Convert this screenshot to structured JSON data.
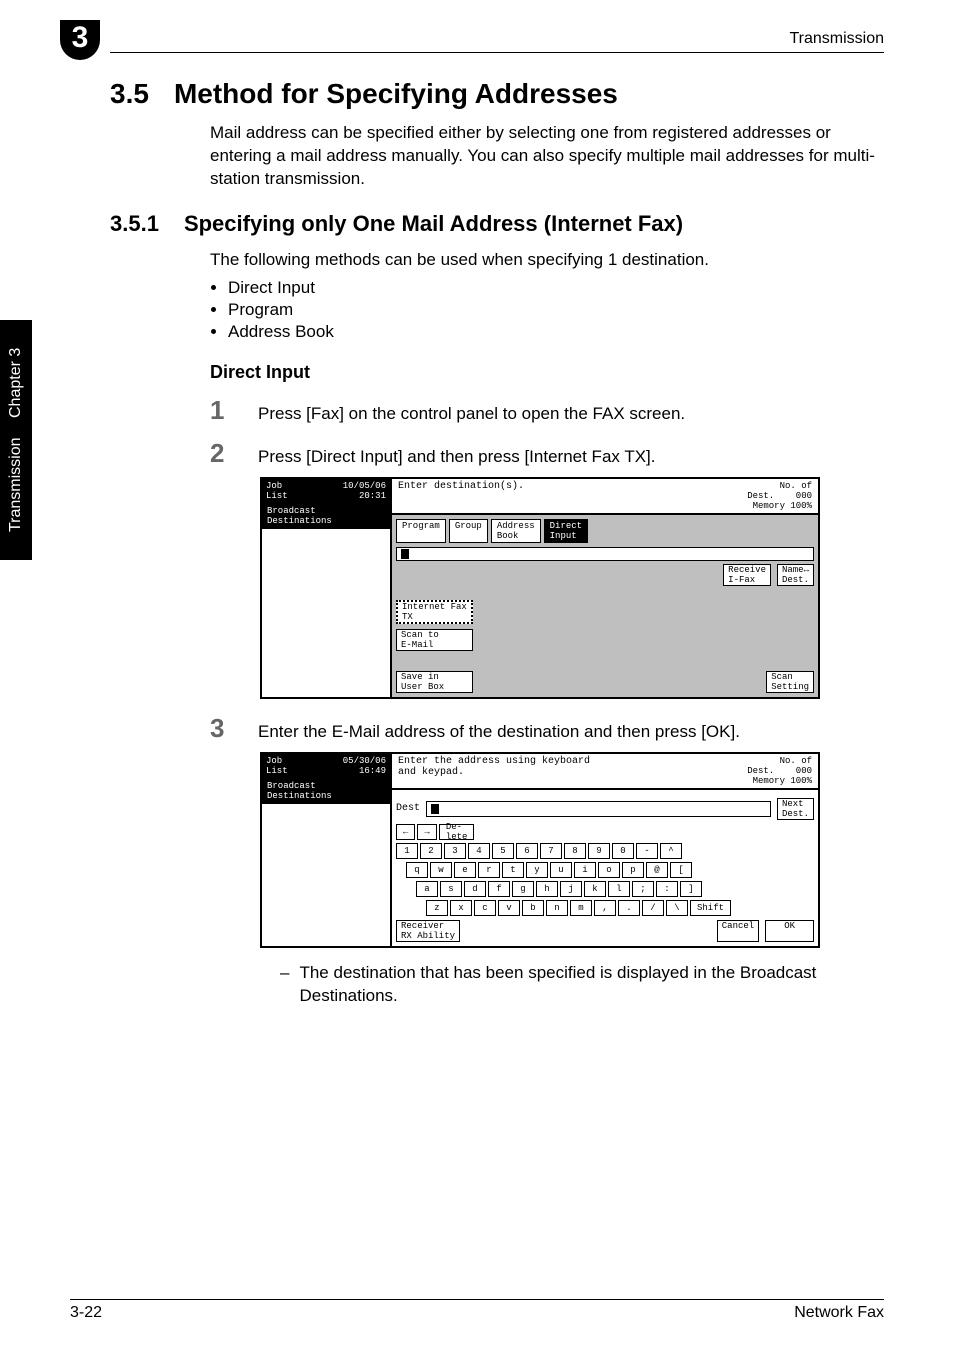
{
  "running_header": "Transmission",
  "chapter_badge": "3",
  "side_tab": {
    "a": "Transmission",
    "b": "Chapter 3"
  },
  "sec": {
    "num": "3.5",
    "title": "Method for Specifying Addresses",
    "intro": "Mail address can be specified either by selecting one from registered addresses or entering a mail address manually. You can also specify multiple mail addresses for multi-station transmission."
  },
  "sub": {
    "num": "3.5.1",
    "title": "Specifying only One Mail Address (Internet Fax)",
    "lead": "The following methods can be used when specifying 1 destination.",
    "bullets": [
      "Direct Input",
      "Program",
      "Address Book"
    ]
  },
  "direct_input": {
    "heading": "Direct Input",
    "steps": {
      "s1": {
        "n": "1",
        "text": "Press [Fax] on the control panel to open the FAX screen."
      },
      "s2": {
        "n": "2",
        "text": "Press [Direct Input] and then press [Internet Fax TX]."
      },
      "s3": {
        "n": "3",
        "text": "Enter the E-Mail address of the destination and then press [OK]."
      }
    },
    "note": "The destination that has been specified is displayed in the Broadcast Destinations."
  },
  "footer": {
    "left": "3-22",
    "right": "Network Fax"
  },
  "screen1": {
    "joblist": "Job\nList",
    "datetime": "10/05/06\n20:31",
    "broadcast": "Broadcast\nDestinations",
    "prompt": "Enter destination(s).",
    "status_right": "No. of\nDest.    000\nMemory 100%",
    "tabs": {
      "program": "Program",
      "group": "Group",
      "addr": "Address\nBook",
      "direct": "Direct\nInput"
    },
    "receive": "Receive\nI-Fax",
    "name": "Name↔\nDest.",
    "opts": {
      "ifax": "Internet Fax\nTX",
      "scan": "Scan to\nE-Mail",
      "save": "Save in\nUser Box"
    },
    "scanset": "Scan\nSetting"
  },
  "screen2": {
    "joblist": "Job\nList",
    "datetime": "05/30/06\n16:49",
    "broadcast": "Broadcast\nDestinations",
    "prompt": "Enter the address using keyboard\nand keypad.",
    "status_right": "No. of\nDest.    000\nMemory 100%",
    "destlabel": "Dest",
    "nextdest": "Next\nDest.",
    "arrows": {
      "l": "←",
      "r": "→",
      "del": "De-\nlete"
    },
    "rows": {
      "r1": [
        "1",
        "2",
        "3",
        "4",
        "5",
        "6",
        "7",
        "8",
        "9",
        "0",
        "-",
        "^"
      ],
      "r2": [
        "q",
        "w",
        "e",
        "r",
        "t",
        "y",
        "u",
        "i",
        "o",
        "p",
        "@",
        "["
      ],
      "r3": [
        "a",
        "s",
        "d",
        "f",
        "g",
        "h",
        "j",
        "k",
        "l",
        ";",
        ":",
        "]"
      ],
      "r4": [
        "z",
        "x",
        "c",
        "v",
        "b",
        "n",
        "m",
        ",",
        ".",
        "/",
        "\\"
      ]
    },
    "shift": "Shift",
    "receiver": "Receiver\nRX Ability",
    "cancel": "Cancel",
    "ok": "OK"
  }
}
